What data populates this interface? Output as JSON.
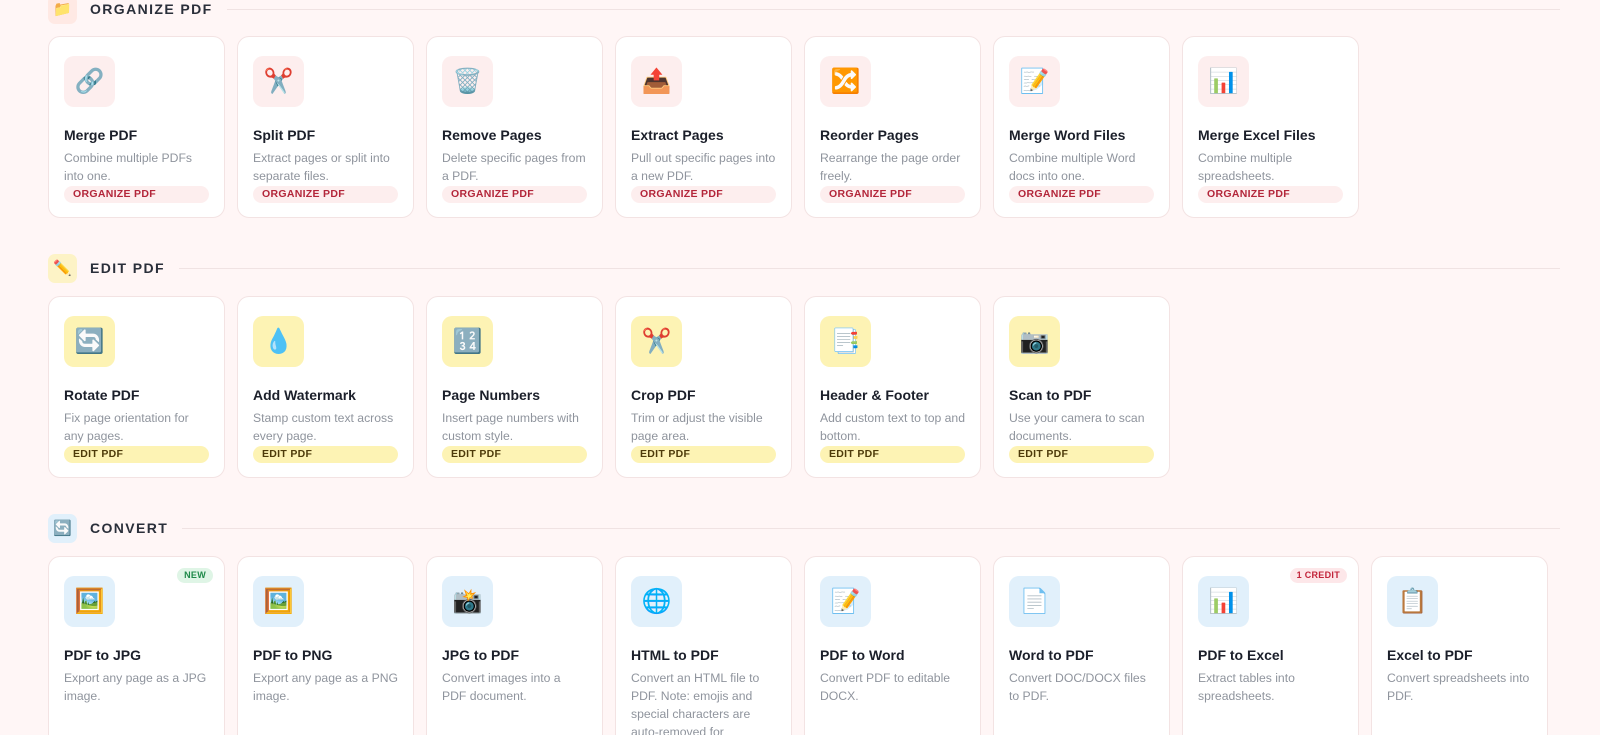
{
  "sections": {
    "organize": {
      "title": "ORGANIZE PDF",
      "icon": "folder-icon",
      "cards": [
        {
          "icon": "🔗",
          "icon_name": "link-icon",
          "title": "Merge PDF",
          "desc": "Combine multiple PDFs into one.",
          "tag": "ORGANIZE PDF"
        },
        {
          "icon": "✂️",
          "icon_name": "scissors-icon",
          "title": "Split PDF",
          "desc": "Extract pages or split into separate files.",
          "tag": "ORGANIZE PDF"
        },
        {
          "icon": "🗑️",
          "icon_name": "trash-icon",
          "title": "Remove Pages",
          "desc": "Delete specific pages from a PDF.",
          "tag": "ORGANIZE PDF"
        },
        {
          "icon": "📤",
          "icon_name": "outbox-icon",
          "title": "Extract Pages",
          "desc": "Pull out specific pages into a new PDF.",
          "tag": "ORGANIZE PDF"
        },
        {
          "icon": "🔀",
          "icon_name": "shuffle-icon",
          "title": "Reorder Pages",
          "desc": "Rearrange the page order freely.",
          "tag": "ORGANIZE PDF"
        },
        {
          "icon": "📝",
          "icon_name": "memo-icon",
          "title": "Merge Word Files",
          "desc": "Combine multiple Word docs into one.",
          "tag": "ORGANIZE PDF"
        },
        {
          "icon": "📊",
          "icon_name": "bar-chart-icon",
          "title": "Merge Excel Files",
          "desc": "Combine multiple spreadsheets.",
          "tag": "ORGANIZE PDF"
        }
      ]
    },
    "edit": {
      "title": "EDIT PDF",
      "icon": "pencil-icon",
      "cards": [
        {
          "icon": "🔄",
          "icon_name": "rotate-icon",
          "title": "Rotate PDF",
          "desc": "Fix page orientation for any pages.",
          "tag": "EDIT PDF"
        },
        {
          "icon": "💧",
          "icon_name": "droplet-icon",
          "title": "Add Watermark",
          "desc": "Stamp custom text across every page.",
          "tag": "EDIT PDF"
        },
        {
          "icon": "🔢",
          "icon_name": "numbers-icon",
          "title": "Page Numbers",
          "desc": "Insert page numbers with custom style.",
          "tag": "EDIT PDF"
        },
        {
          "icon": "✂️",
          "icon_name": "scissors-icon",
          "title": "Crop PDF",
          "desc": "Trim or adjust the visible page area.",
          "tag": "EDIT PDF"
        },
        {
          "icon": "📑",
          "icon_name": "bookmark-tabs-icon",
          "title": "Header & Footer",
          "desc": "Add custom text to top and bottom.",
          "tag": "EDIT PDF"
        },
        {
          "icon": "📷",
          "icon_name": "camera-icon",
          "title": "Scan to PDF",
          "desc": "Use your camera to scan documents.",
          "tag": "EDIT PDF"
        }
      ]
    },
    "convert": {
      "title": "CONVERT",
      "icon": "rotate-icon",
      "cards": [
        {
          "icon": "🖼️",
          "icon_name": "picture-icon",
          "title": "PDF to JPG",
          "desc": "Export any page as a JPG image.",
          "badge": "NEW",
          "badge_type": "new"
        },
        {
          "icon": "🖼️",
          "icon_name": "picture-icon",
          "title": "PDF to PNG",
          "desc": "Export any page as a PNG image."
        },
        {
          "icon": "📸",
          "icon_name": "camera-flash-icon",
          "title": "JPG to PDF",
          "desc": "Convert images into a PDF document."
        },
        {
          "icon": "🌐",
          "icon_name": "globe-icon",
          "title": "HTML to PDF",
          "desc": "Convert an HTML file to PDF. Note: emojis and special characters are auto-removed for"
        },
        {
          "icon": "📝",
          "icon_name": "memo-icon",
          "title": "PDF to Word",
          "desc": "Convert PDF to editable DOCX."
        },
        {
          "icon": "📄",
          "icon_name": "page-icon",
          "title": "Word to PDF",
          "desc": "Convert DOC/DOCX files to PDF."
        },
        {
          "icon": "📊",
          "icon_name": "bar-chart-icon",
          "title": "PDF to Excel",
          "desc": "Extract tables into spreadsheets.",
          "badge": "1 CREDIT",
          "badge_type": "credit"
        },
        {
          "icon": "📋",
          "icon_name": "clipboard-icon",
          "title": "Excel to PDF",
          "desc": "Convert spreadsheets into PDF."
        }
      ]
    }
  },
  "section_glyphs": {
    "organize": "📁",
    "edit": "✏️",
    "convert": "🔄"
  }
}
